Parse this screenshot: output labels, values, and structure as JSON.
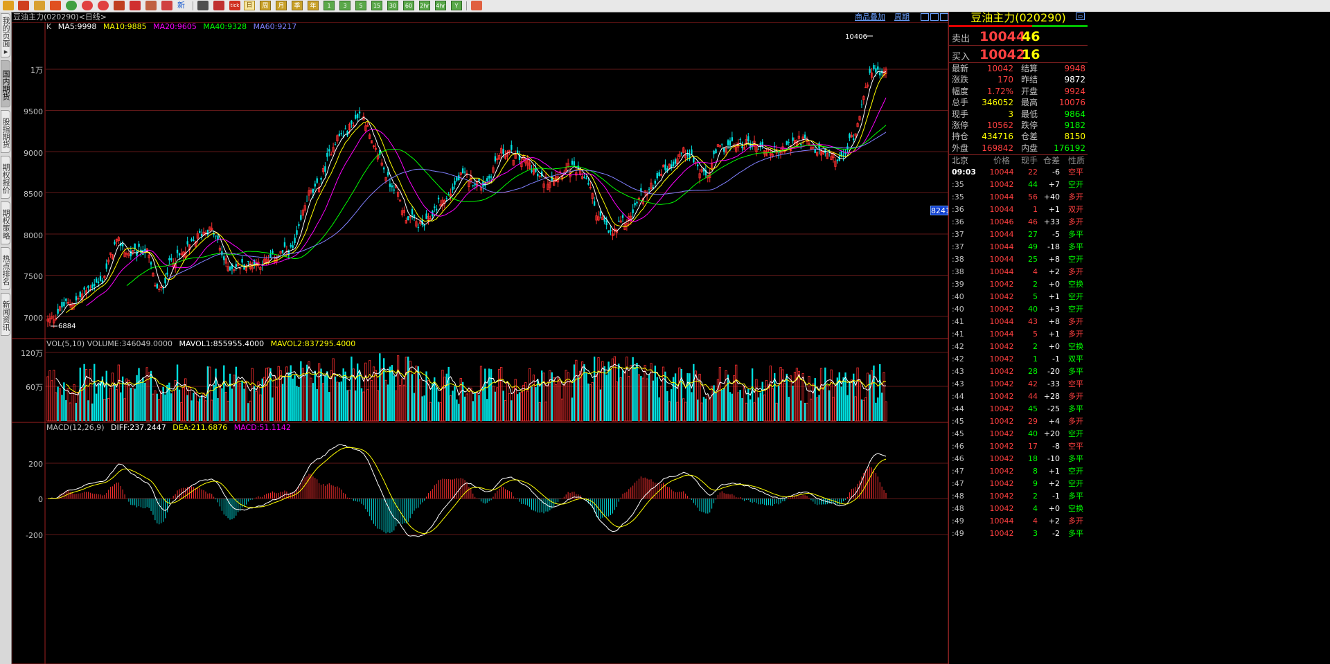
{
  "toolbar": {
    "new_label": "新",
    "tick_label": "tick",
    "periods": [
      "日",
      "周",
      "月",
      "季",
      "年",
      "1",
      "3",
      "5",
      "15",
      "30",
      "60",
      "2hr",
      "4hr",
      "Y"
    ]
  },
  "sidebar": {
    "tabs": [
      {
        "label": "我的页面▸",
        "active": false
      },
      {
        "label": "国内期货",
        "active": true
      },
      {
        "label": "股指期货",
        "active": false
      },
      {
        "label": "期权报价",
        "active": false
      },
      {
        "label": "期权策略",
        "active": false
      },
      {
        "label": "热点排名",
        "active": false
      },
      {
        "label": "新闻资讯",
        "active": false
      }
    ]
  },
  "chart": {
    "title": "豆油主力(020290)<日线>",
    "link_products": "商品叠加",
    "link_period": "周期",
    "ma_legend": {
      "k": "K",
      "ma5": "MA5:9998",
      "ma10": "MA10:9885",
      "ma20": "MA20:9605",
      "ma40": "MA40:9328",
      "ma60": "MA60:9217"
    },
    "vol_legend": {
      "vol": "VOL(5,10) VOLUME:346049.0000",
      "mavol1": "MAVOL1:855955.4000",
      "mavol2": "MAVOL2:837295.4000"
    },
    "macd_legend": {
      "macd": "MACD(12,26,9)",
      "diff": "DIFF:237.2447",
      "dea": "DEA:211.6876",
      "macdv": "MACD:51.1142"
    },
    "high_label": "10406",
    "low_label": "6884",
    "price_tag": "8241",
    "price_ticks": [
      "1万",
      "9500",
      "9000",
      "8500",
      "8000",
      "7500",
      "7000"
    ],
    "vol_ticks": [
      "120万",
      "60万"
    ],
    "macd_ticks": [
      "200",
      "0",
      "-200"
    ],
    "colors": {
      "up": "#ff3030",
      "down": "#00e0e0",
      "ma5": "#ffffff",
      "ma10": "#ffff00",
      "ma20": "#ff00ff",
      "ma40": "#00ff00",
      "ma60": "#8080ff"
    }
  },
  "chart_data": {
    "type": "candlestick",
    "title": "豆油主力(020290)",
    "ylim": [
      6884,
      10406
    ],
    "last": {
      "ma5": 9998,
      "ma10": 9885,
      "ma20": 9605,
      "ma40": 9328,
      "ma60": 9217,
      "volume": 346049,
      "mavol1": 855955.4,
      "mavol2": 837295.4,
      "diff": 237.2447,
      "dea": 211.6876,
      "macd": 51.1142
    }
  },
  "quote": {
    "title": "豆油主力(020290)",
    "sell": {
      "label": "卖出",
      "price": "10044",
      "vol": "46"
    },
    "buy": {
      "label": "买入",
      "price": "10042",
      "vol": "16"
    },
    "stats": [
      {
        "l1": "最新",
        "v1": "10042",
        "c1": "#ff4040",
        "l2": "结算",
        "v2": "9948",
        "c2": "#ff4040"
      },
      {
        "l1": "涨跌",
        "v1": "170",
        "c1": "#ff4040",
        "l2": "昨结",
        "v2": "9872",
        "c2": "#ffffff"
      },
      {
        "l1": "幅度",
        "v1": "1.72%",
        "c1": "#ff4040",
        "l2": "开盘",
        "v2": "9924",
        "c2": "#ff4040"
      },
      {
        "l1": "总手",
        "v1": "346052",
        "c1": "#ffff00",
        "l2": "最高",
        "v2": "10076",
        "c2": "#ff4040"
      },
      {
        "l1": "现手",
        "v1": "3",
        "c1": "#ffff00",
        "l2": "最低",
        "v2": "9864",
        "c2": "#00ff00"
      },
      {
        "l1": "涨停",
        "v1": "10562",
        "c1": "#ff4040",
        "l2": "跌停",
        "v2": "9182",
        "c2": "#00ff00"
      },
      {
        "l1": "持仓",
        "v1": "434716",
        "c1": "#ffff00",
        "l2": "仓差",
        "v2": "8150",
        "c2": "#ffff00"
      },
      {
        "l1": "外盘",
        "v1": "169842",
        "c1": "#ff4040",
        "l2": "内盘",
        "v2": "176192",
        "c2": "#00ff00"
      }
    ],
    "tick_header": {
      "time": "北京",
      "price": "价格",
      "vol": "现手",
      "chg": "仓差",
      "nature": "性质"
    },
    "ticks": [
      {
        "t": "09:03",
        "p": "10044",
        "v": "22",
        "c": "-6",
        "n": "空平",
        "pc": "#ff4040",
        "vc": "#ff4040",
        "cc": "#ffffff",
        "nc": "#ff4040"
      },
      {
        "t": ":35",
        "p": "10042",
        "v": "44",
        "c": "+7",
        "n": "空开",
        "pc": "#ff4040",
        "vc": "#00ff00",
        "cc": "#ffffff",
        "nc": "#00ff00"
      },
      {
        "t": ":35",
        "p": "10044",
        "v": "56",
        "c": "+40",
        "n": "多开",
        "pc": "#ff4040",
        "vc": "#ff4040",
        "cc": "#ffffff",
        "nc": "#ff4040"
      },
      {
        "t": ":36",
        "p": "10044",
        "v": "1",
        "c": "+1",
        "n": "双开",
        "pc": "#ff4040",
        "vc": "#ff4040",
        "cc": "#ffffff",
        "nc": "#ff4040"
      },
      {
        "t": ":36",
        "p": "10046",
        "v": "46",
        "c": "+33",
        "n": "多开",
        "pc": "#ff4040",
        "vc": "#ff4040",
        "cc": "#ffffff",
        "nc": "#ff4040"
      },
      {
        "t": ":37",
        "p": "10044",
        "v": "27",
        "c": "-5",
        "n": "多平",
        "pc": "#ff4040",
        "vc": "#00ff00",
        "cc": "#ffffff",
        "nc": "#00ff00"
      },
      {
        "t": ":37",
        "p": "10044",
        "v": "49",
        "c": "-18",
        "n": "多平",
        "pc": "#ff4040",
        "vc": "#00ff00",
        "cc": "#ffffff",
        "nc": "#00ff00"
      },
      {
        "t": ":38",
        "p": "10044",
        "v": "25",
        "c": "+8",
        "n": "空开",
        "pc": "#ff4040",
        "vc": "#00ff00",
        "cc": "#ffffff",
        "nc": "#00ff00"
      },
      {
        "t": ":38",
        "p": "10044",
        "v": "4",
        "c": "+2",
        "n": "多开",
        "pc": "#ff4040",
        "vc": "#ff4040",
        "cc": "#ffffff",
        "nc": "#ff4040"
      },
      {
        "t": ":39",
        "p": "10042",
        "v": "2",
        "c": "+0",
        "n": "空换",
        "pc": "#ff4040",
        "vc": "#00ff00",
        "cc": "#ffffff",
        "nc": "#00ff00"
      },
      {
        "t": ":40",
        "p": "10042",
        "v": "5",
        "c": "+1",
        "n": "空开",
        "pc": "#ff4040",
        "vc": "#00ff00",
        "cc": "#ffffff",
        "nc": "#00ff00"
      },
      {
        "t": ":40",
        "p": "10042",
        "v": "40",
        "c": "+3",
        "n": "空开",
        "pc": "#ff4040",
        "vc": "#00ff00",
        "cc": "#ffffff",
        "nc": "#00ff00"
      },
      {
        "t": ":41",
        "p": "10044",
        "v": "43",
        "c": "+8",
        "n": "多开",
        "pc": "#ff4040",
        "vc": "#ff4040",
        "cc": "#ffffff",
        "nc": "#ff4040"
      },
      {
        "t": ":41",
        "p": "10044",
        "v": "5",
        "c": "+1",
        "n": "多开",
        "pc": "#ff4040",
        "vc": "#ff4040",
        "cc": "#ffffff",
        "nc": "#ff4040"
      },
      {
        "t": ":42",
        "p": "10042",
        "v": "2",
        "c": "+0",
        "n": "空换",
        "pc": "#ff4040",
        "vc": "#00ff00",
        "cc": "#ffffff",
        "nc": "#00ff00"
      },
      {
        "t": ":42",
        "p": "10042",
        "v": "1",
        "c": "-1",
        "n": "双平",
        "pc": "#ff4040",
        "vc": "#00ff00",
        "cc": "#ffffff",
        "nc": "#00ff00"
      },
      {
        "t": ":43",
        "p": "10042",
        "v": "28",
        "c": "-20",
        "n": "多平",
        "pc": "#ff4040",
        "vc": "#00ff00",
        "cc": "#ffffff",
        "nc": "#00ff00"
      },
      {
        "t": ":43",
        "p": "10042",
        "v": "42",
        "c": "-33",
        "n": "空平",
        "pc": "#ff4040",
        "vc": "#ff4040",
        "cc": "#ffffff",
        "nc": "#ff4040"
      },
      {
        "t": ":44",
        "p": "10042",
        "v": "44",
        "c": "+28",
        "n": "多开",
        "pc": "#ff4040",
        "vc": "#ff4040",
        "cc": "#ffffff",
        "nc": "#ff4040"
      },
      {
        "t": ":44",
        "p": "10042",
        "v": "45",
        "c": "-25",
        "n": "多平",
        "pc": "#ff4040",
        "vc": "#00ff00",
        "cc": "#ffffff",
        "nc": "#00ff00"
      },
      {
        "t": ":45",
        "p": "10042",
        "v": "29",
        "c": "+4",
        "n": "多开",
        "pc": "#ff4040",
        "vc": "#ff4040",
        "cc": "#ffffff",
        "nc": "#ff4040"
      },
      {
        "t": ":45",
        "p": "10042",
        "v": "40",
        "c": "+20",
        "n": "空开",
        "pc": "#ff4040",
        "vc": "#00ff00",
        "cc": "#ffffff",
        "nc": "#00ff00"
      },
      {
        "t": ":46",
        "p": "10042",
        "v": "17",
        "c": "-8",
        "n": "空平",
        "pc": "#ff4040",
        "vc": "#ff4040",
        "cc": "#ffffff",
        "nc": "#ff4040"
      },
      {
        "t": ":46",
        "p": "10042",
        "v": "18",
        "c": "-10",
        "n": "多平",
        "pc": "#ff4040",
        "vc": "#00ff00",
        "cc": "#ffffff",
        "nc": "#00ff00"
      },
      {
        "t": ":47",
        "p": "10042",
        "v": "8",
        "c": "+1",
        "n": "空开",
        "pc": "#ff4040",
        "vc": "#00ff00",
        "cc": "#ffffff",
        "nc": "#00ff00"
      },
      {
        "t": ":47",
        "p": "10042",
        "v": "9",
        "c": "+2",
        "n": "空开",
        "pc": "#ff4040",
        "vc": "#00ff00",
        "cc": "#ffffff",
        "nc": "#00ff00"
      },
      {
        "t": ":48",
        "p": "10042",
        "v": "2",
        "c": "-1",
        "n": "多平",
        "pc": "#ff4040",
        "vc": "#00ff00",
        "cc": "#ffffff",
        "nc": "#00ff00"
      },
      {
        "t": ":48",
        "p": "10042",
        "v": "4",
        "c": "+0",
        "n": "空换",
        "pc": "#ff4040",
        "vc": "#00ff00",
        "cc": "#ffffff",
        "nc": "#00ff00"
      },
      {
        "t": ":49",
        "p": "10044",
        "v": "4",
        "c": "+2",
        "n": "多开",
        "pc": "#ff4040",
        "vc": "#ff4040",
        "cc": "#ffffff",
        "nc": "#ff4040"
      },
      {
        "t": ":49",
        "p": "10042",
        "v": "3",
        "c": "-2",
        "n": "多平",
        "pc": "#ff4040",
        "vc": "#00ff00",
        "cc": "#ffffff",
        "nc": "#00ff00"
      }
    ]
  }
}
